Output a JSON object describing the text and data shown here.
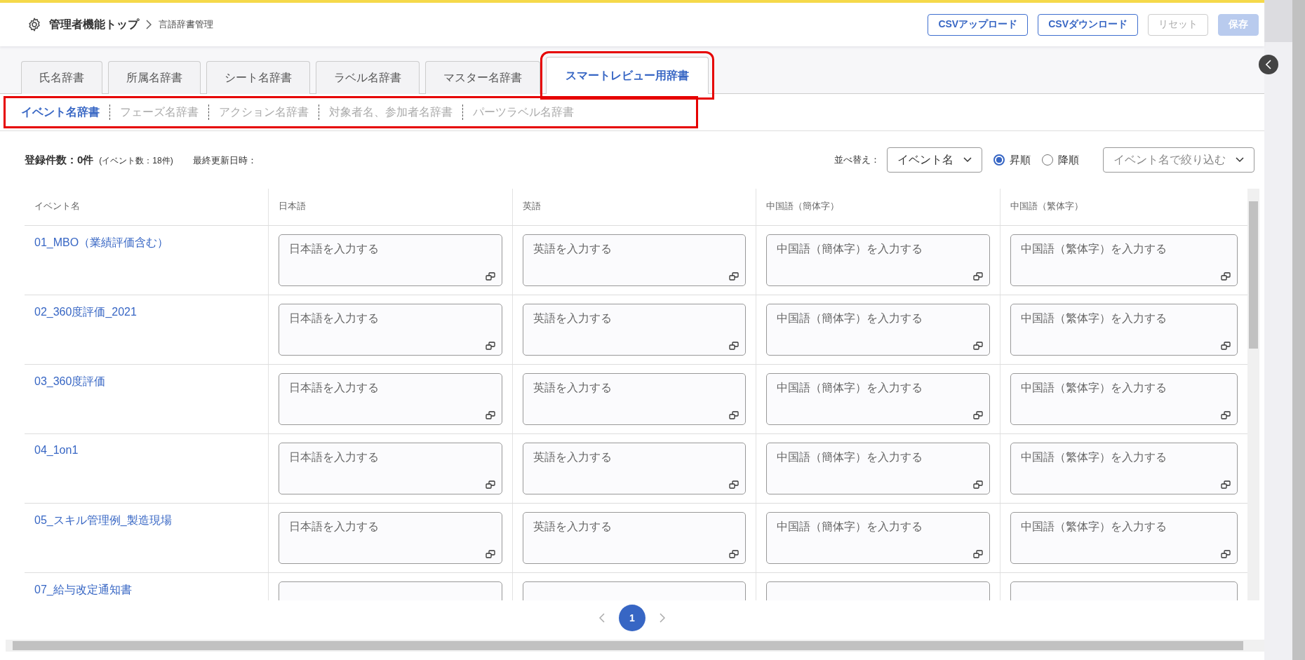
{
  "header": {
    "breadcrumb": [
      {
        "label": "管理者機能トップ"
      },
      {
        "label": "言語辞書管理"
      }
    ],
    "buttons": [
      {
        "label": "CSVアップロード",
        "kind": "outline",
        "disabled": false
      },
      {
        "label": "CSVダウンロード",
        "kind": "outline",
        "disabled": false
      },
      {
        "label": "リセット",
        "kind": "outline",
        "disabled": true
      },
      {
        "label": "保存",
        "kind": "primary",
        "disabled": true
      }
    ]
  },
  "tabs": [
    {
      "label": "氏名辞書",
      "selected": false,
      "highlighted": false
    },
    {
      "label": "所属名辞書",
      "selected": false,
      "highlighted": false
    },
    {
      "label": "シート名辞書",
      "selected": false,
      "highlighted": false
    },
    {
      "label": "ラベル名辞書",
      "selected": false,
      "highlighted": false
    },
    {
      "label": "マスター名辞書",
      "selected": false,
      "highlighted": false
    },
    {
      "label": "スマートレビュー用辞書",
      "selected": true,
      "highlighted": true
    }
  ],
  "subtabs": {
    "highlighted": true,
    "items": [
      {
        "label": "イベント名辞書",
        "selected": true
      },
      {
        "label": "フェーズ名辞書",
        "selected": false
      },
      {
        "label": "アクション名辞書",
        "selected": false
      },
      {
        "label": "対象者名、参加者名辞書",
        "selected": false
      },
      {
        "label": "パーツラベル名辞書",
        "selected": false
      }
    ]
  },
  "summary": {
    "count": "登録件数：0件",
    "event_count": "(イベント数：18件)",
    "updated": "最終更新日時："
  },
  "sort": {
    "label": "並べ替え：",
    "value": "イベント名",
    "orders": [
      {
        "label": "昇順",
        "selected": true
      },
      {
        "label": "降順",
        "selected": false
      }
    ]
  },
  "filter": {
    "placeholder": "イベント名で絞り込む"
  },
  "table": {
    "columns": [
      "イベント名",
      "日本語",
      "英語",
      "中国語（簡体字）",
      "中国語（繁体字）"
    ],
    "rows": [
      {
        "name": "01_MBO（業績評価含む）",
        "placeholders": [
          "日本語を入力する",
          "英語を入力する",
          "中国語（簡体字）を入力する",
          "中国語（繁体字）を入力する"
        ]
      },
      {
        "name": "02_360度評価_2021",
        "placeholders": [
          "日本語を入力する",
          "英語を入力する",
          "中国語（簡体字）を入力する",
          "中国語（繁体字）を入力する"
        ]
      },
      {
        "name": "03_360度評価",
        "placeholders": [
          "日本語を入力する",
          "英語を入力する",
          "中国語（簡体字）を入力する",
          "中国語（繁体字）を入力する"
        ]
      },
      {
        "name": "04_1on1",
        "placeholders": [
          "日本語を入力する",
          "英語を入力する",
          "中国語（簡体字）を入力する",
          "中国語（繁体字）を入力する"
        ]
      },
      {
        "name": "05_スキル管理例_製造現場",
        "placeholders": [
          "日本語を入力する",
          "英語を入力する",
          "中国語（簡体字）を入力する",
          "中国語（繁体字）を入力する"
        ]
      },
      {
        "name": "07_給与改定通知書"
      }
    ]
  },
  "pagination": {
    "pages": [
      {
        "label": "1",
        "selected": true
      }
    ]
  }
}
